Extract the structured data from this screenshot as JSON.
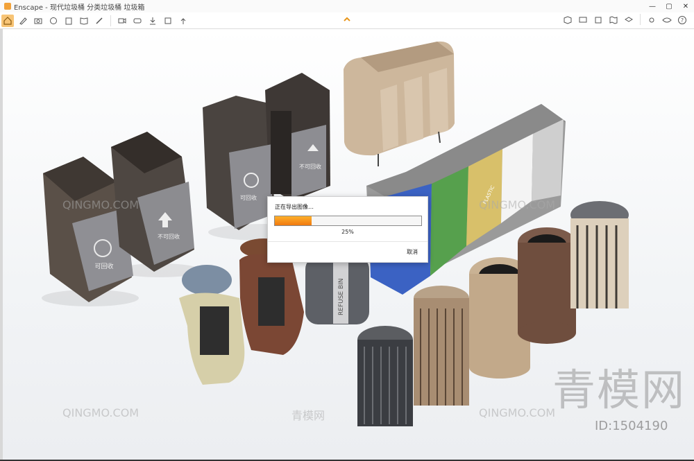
{
  "window": {
    "app_name": "Enscape",
    "title": "Enscape - 现代垃圾桶 分类垃圾桶 垃圾箱",
    "controls": [
      "—",
      "▢",
      "✕"
    ]
  },
  "toolbar": {
    "icons": [
      "home-icon",
      "brush-icon",
      "screenshot-icon",
      "orbit-icon",
      "building-icon",
      "book-icon",
      "ruler-icon",
      "video-icon",
      "panorama-icon",
      "export-icon",
      "render-icon",
      "upload-icon"
    ],
    "right_icons": [
      "asset-icon",
      "screen-icon",
      "cube-icon",
      "map-icon",
      "layers-icon",
      "settings-icon",
      "view-icon",
      "help-icon"
    ],
    "help_label": "?"
  },
  "dialog": {
    "heading": "正在导出图像…",
    "progress": 0.25,
    "percent_label": "25%",
    "cancel_label": "取消",
    "fill_color": "#f28a12"
  },
  "scene": {
    "bin_labels": {
      "recycle_cn": "可回收",
      "nonrecycle_cn": "不可回收",
      "refuse": "REFUSE BIN",
      "plastic": "PLASTIC"
    }
  },
  "watermarks": {
    "latin": "QINGMO.COM",
    "chinese_small": "青模网",
    "chinese_big": "青模网",
    "id_label": "ID:1504190"
  }
}
